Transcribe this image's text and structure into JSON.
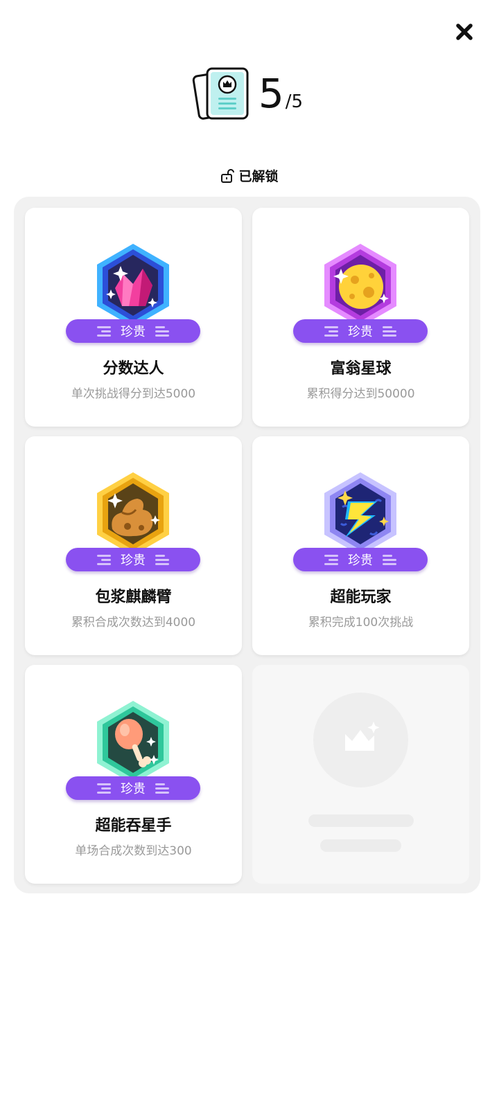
{
  "header": {
    "progress_current": "5",
    "progress_total": "/5",
    "icon": "certificate-icon",
    "close_icon": "close-icon"
  },
  "section": {
    "label": "已解锁",
    "icon": "unlock-icon"
  },
  "achievements": [
    {
      "title": "分数达人",
      "rarity": "珍贵",
      "description": "单次挑战得分到达5000",
      "icon": "pink-crystal-badge-icon"
    },
    {
      "title": "富翁星球",
      "rarity": "珍贵",
      "description": "累积得分达到50000",
      "icon": "cheese-planet-badge-icon"
    },
    {
      "title": "包浆麒麟臂",
      "rarity": "珍贵",
      "description": "累积合成次数达到4000",
      "icon": "muscle-arm-badge-icon"
    },
    {
      "title": "超能玩家",
      "rarity": "珍贵",
      "description": "累积完成100次挑战",
      "icon": "lightning-badge-icon"
    },
    {
      "title": "超能吞星手",
      "rarity": "珍贵",
      "description": "单场合成次数到达300",
      "icon": "drumstick-badge-icon"
    }
  ],
  "locked_placeholder": {
    "icon": "crown-placeholder-icon"
  },
  "colors": {
    "rarity_pill": "#8a51f0",
    "panel_bg": "#f1f1f1"
  }
}
